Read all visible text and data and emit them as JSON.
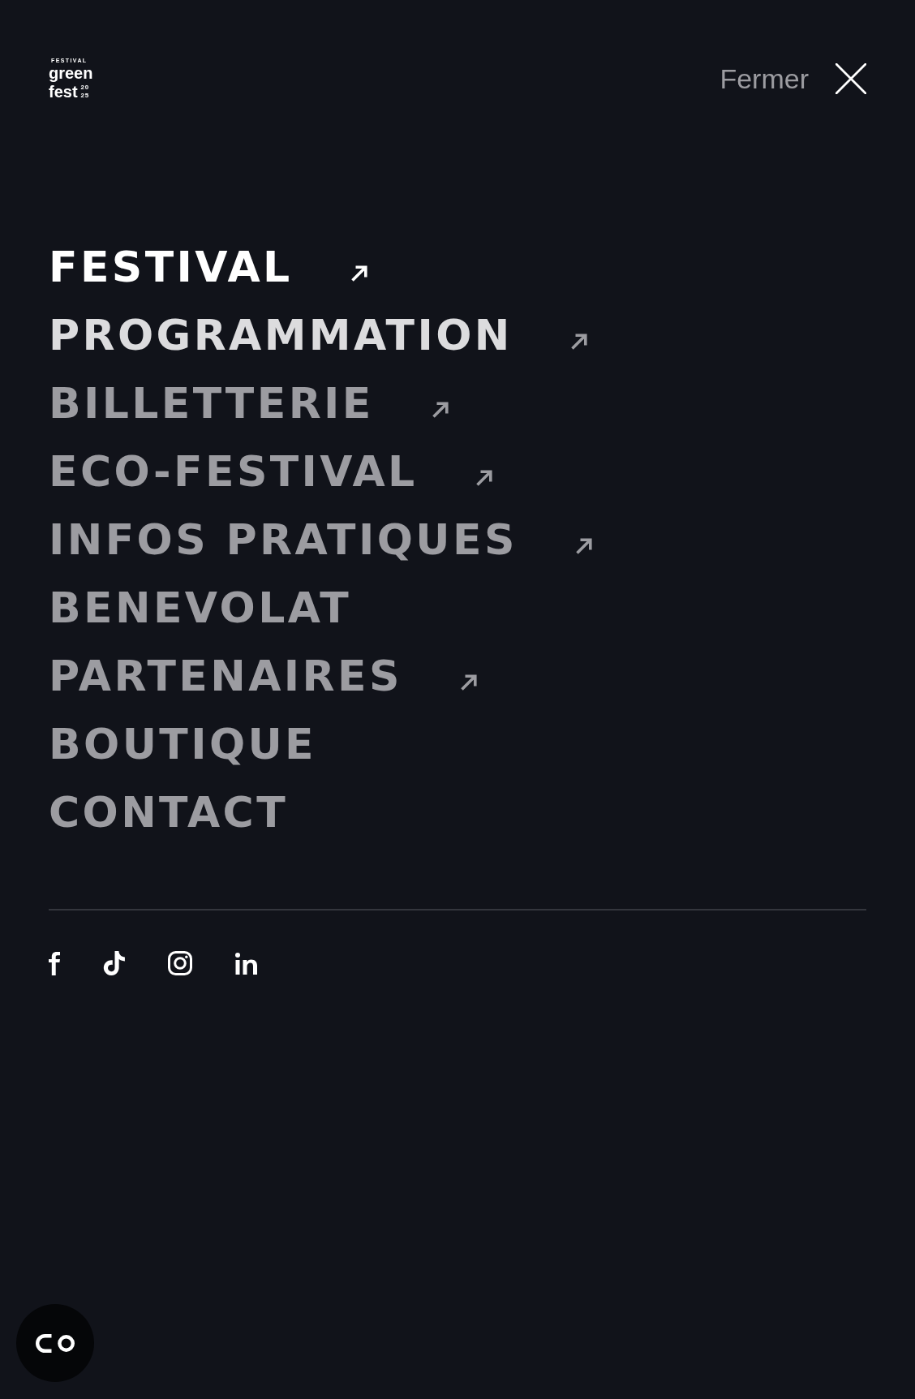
{
  "header": {
    "logo": {
      "kicker": "FESTIVAL",
      "word_1": "green",
      "word_2": "fest",
      "year_1": "20",
      "year_2": "25"
    },
    "close_button": {
      "label": "Fermer"
    }
  },
  "menu": {
    "items": [
      {
        "label": "FESTIVAL",
        "arrow": true,
        "selected": true,
        "hovered": false
      },
      {
        "label": "PROGRAMMATION",
        "arrow": true,
        "selected": false,
        "hovered": true
      },
      {
        "label": "BILLETTERIE",
        "arrow": true,
        "selected": false,
        "hovered": false
      },
      {
        "label": "ECO-FESTIVAL",
        "arrow": true,
        "selected": false,
        "hovered": false
      },
      {
        "label": "INFOS PRATIQUES",
        "arrow": true,
        "selected": false,
        "hovered": false
      },
      {
        "label": "BENEVOLAT",
        "arrow": false,
        "selected": false,
        "hovered": false
      },
      {
        "label": "PARTENAIRES",
        "arrow": true,
        "selected": false,
        "hovered": false
      },
      {
        "label": "BOUTIQUE",
        "arrow": false,
        "selected": false,
        "hovered": false
      },
      {
        "label": "CONTACT",
        "arrow": false,
        "selected": false,
        "hovered": false
      }
    ]
  },
  "social": {
    "links": [
      {
        "kind": "facebook"
      },
      {
        "kind": "tiktok"
      },
      {
        "kind": "instagram"
      },
      {
        "kind": "linkedin"
      }
    ]
  }
}
